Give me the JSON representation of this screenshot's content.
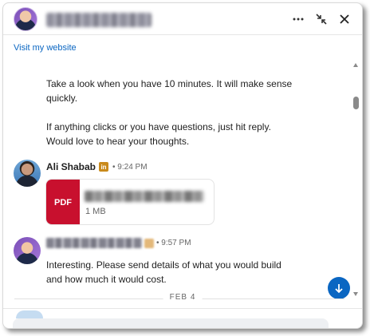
{
  "header": {
    "more_icon": "more-horizontal-icon",
    "minimize_icon": "minimize-arrows-icon",
    "close_icon": "close-icon"
  },
  "website_link": "Visit my website",
  "messages": {
    "first_para_1": "Take a look when you have 10 minutes. It will make sense",
    "first_para_2": "quickly.",
    "second_para_1": "If anything clicks or you have questions, just hit reply.",
    "second_para_2": "Would love to hear your thoughts.",
    "ali": {
      "name": "Ali Shabab",
      "badge": "in",
      "time": "• 9:24 PM"
    },
    "attachment": {
      "type_label": "PDF",
      "size": "1 MB"
    },
    "reply": {
      "time": "• 9:57 PM",
      "line_1": "Interesting. Please send details of what you would build",
      "line_2": "and how much it would cost."
    }
  },
  "date_divider": "FEB 4",
  "colors": {
    "accent": "#0a66c2",
    "pdf": "#c8102e",
    "badge": "#c98a1c"
  }
}
